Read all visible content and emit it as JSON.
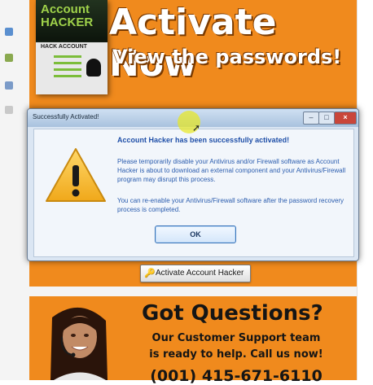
{
  "banner": {
    "box_title": "Account HACKER",
    "box_subtitle": "HACK ACCOUNT",
    "headline": "Activate Now",
    "subheadline": "View the passwords!"
  },
  "dialog": {
    "title": "Successfully Activated!",
    "heading": "Account Hacker has been successfully activated!",
    "body1": "Please temporarily disable your Antivirus and/or Firewall software as Account Hacker is about to download an external component and your Antivirus/Firewall program may disrupt this process.",
    "body2": "You can re-enable your Antivirus/Firewall software after the password recovery process is completed.",
    "ok_label": "OK",
    "minimize_glyph": "–",
    "maximize_glyph": "□",
    "close_glyph": "×"
  },
  "activate_button": {
    "label": "Activate Account Hacker"
  },
  "support": {
    "title": "Got Questions?",
    "line1": "Our Customer Support team",
    "line2": "is ready to help. Call us now!",
    "phone": "(001) 415-671-6110"
  },
  "icons": {
    "warning": "warning-icon",
    "key": "key-icon",
    "cursor": "cursor-icon"
  },
  "colors": {
    "brand_orange": "#f08a1d",
    "dialog_text": "#2a5cae",
    "dialog_heading": "#1f4fa8"
  }
}
